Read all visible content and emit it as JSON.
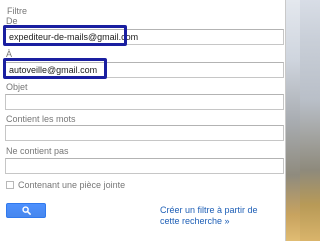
{
  "filter": {
    "title": "Filtre",
    "from": {
      "label": "De",
      "value": "expediteur-de-mails@gmail.com"
    },
    "to": {
      "label": "À",
      "value": "autoveille@gmail.com"
    },
    "subject": {
      "label": "Objet",
      "value": ""
    },
    "has_words": {
      "label": "Contient les mots",
      "value": ""
    },
    "doesnt_have": {
      "label": "Ne contient pas",
      "value": ""
    },
    "has_attachment": {
      "label": "Contenant une pièce jointe",
      "checked": false
    },
    "search_button_icon": "search-icon",
    "create_filter_link": "Créer un filtre à partir de cette recherche »"
  },
  "colors": {
    "highlight": "#1a1fa0",
    "button": "#4d90fe",
    "link": "#1e5fb6"
  }
}
